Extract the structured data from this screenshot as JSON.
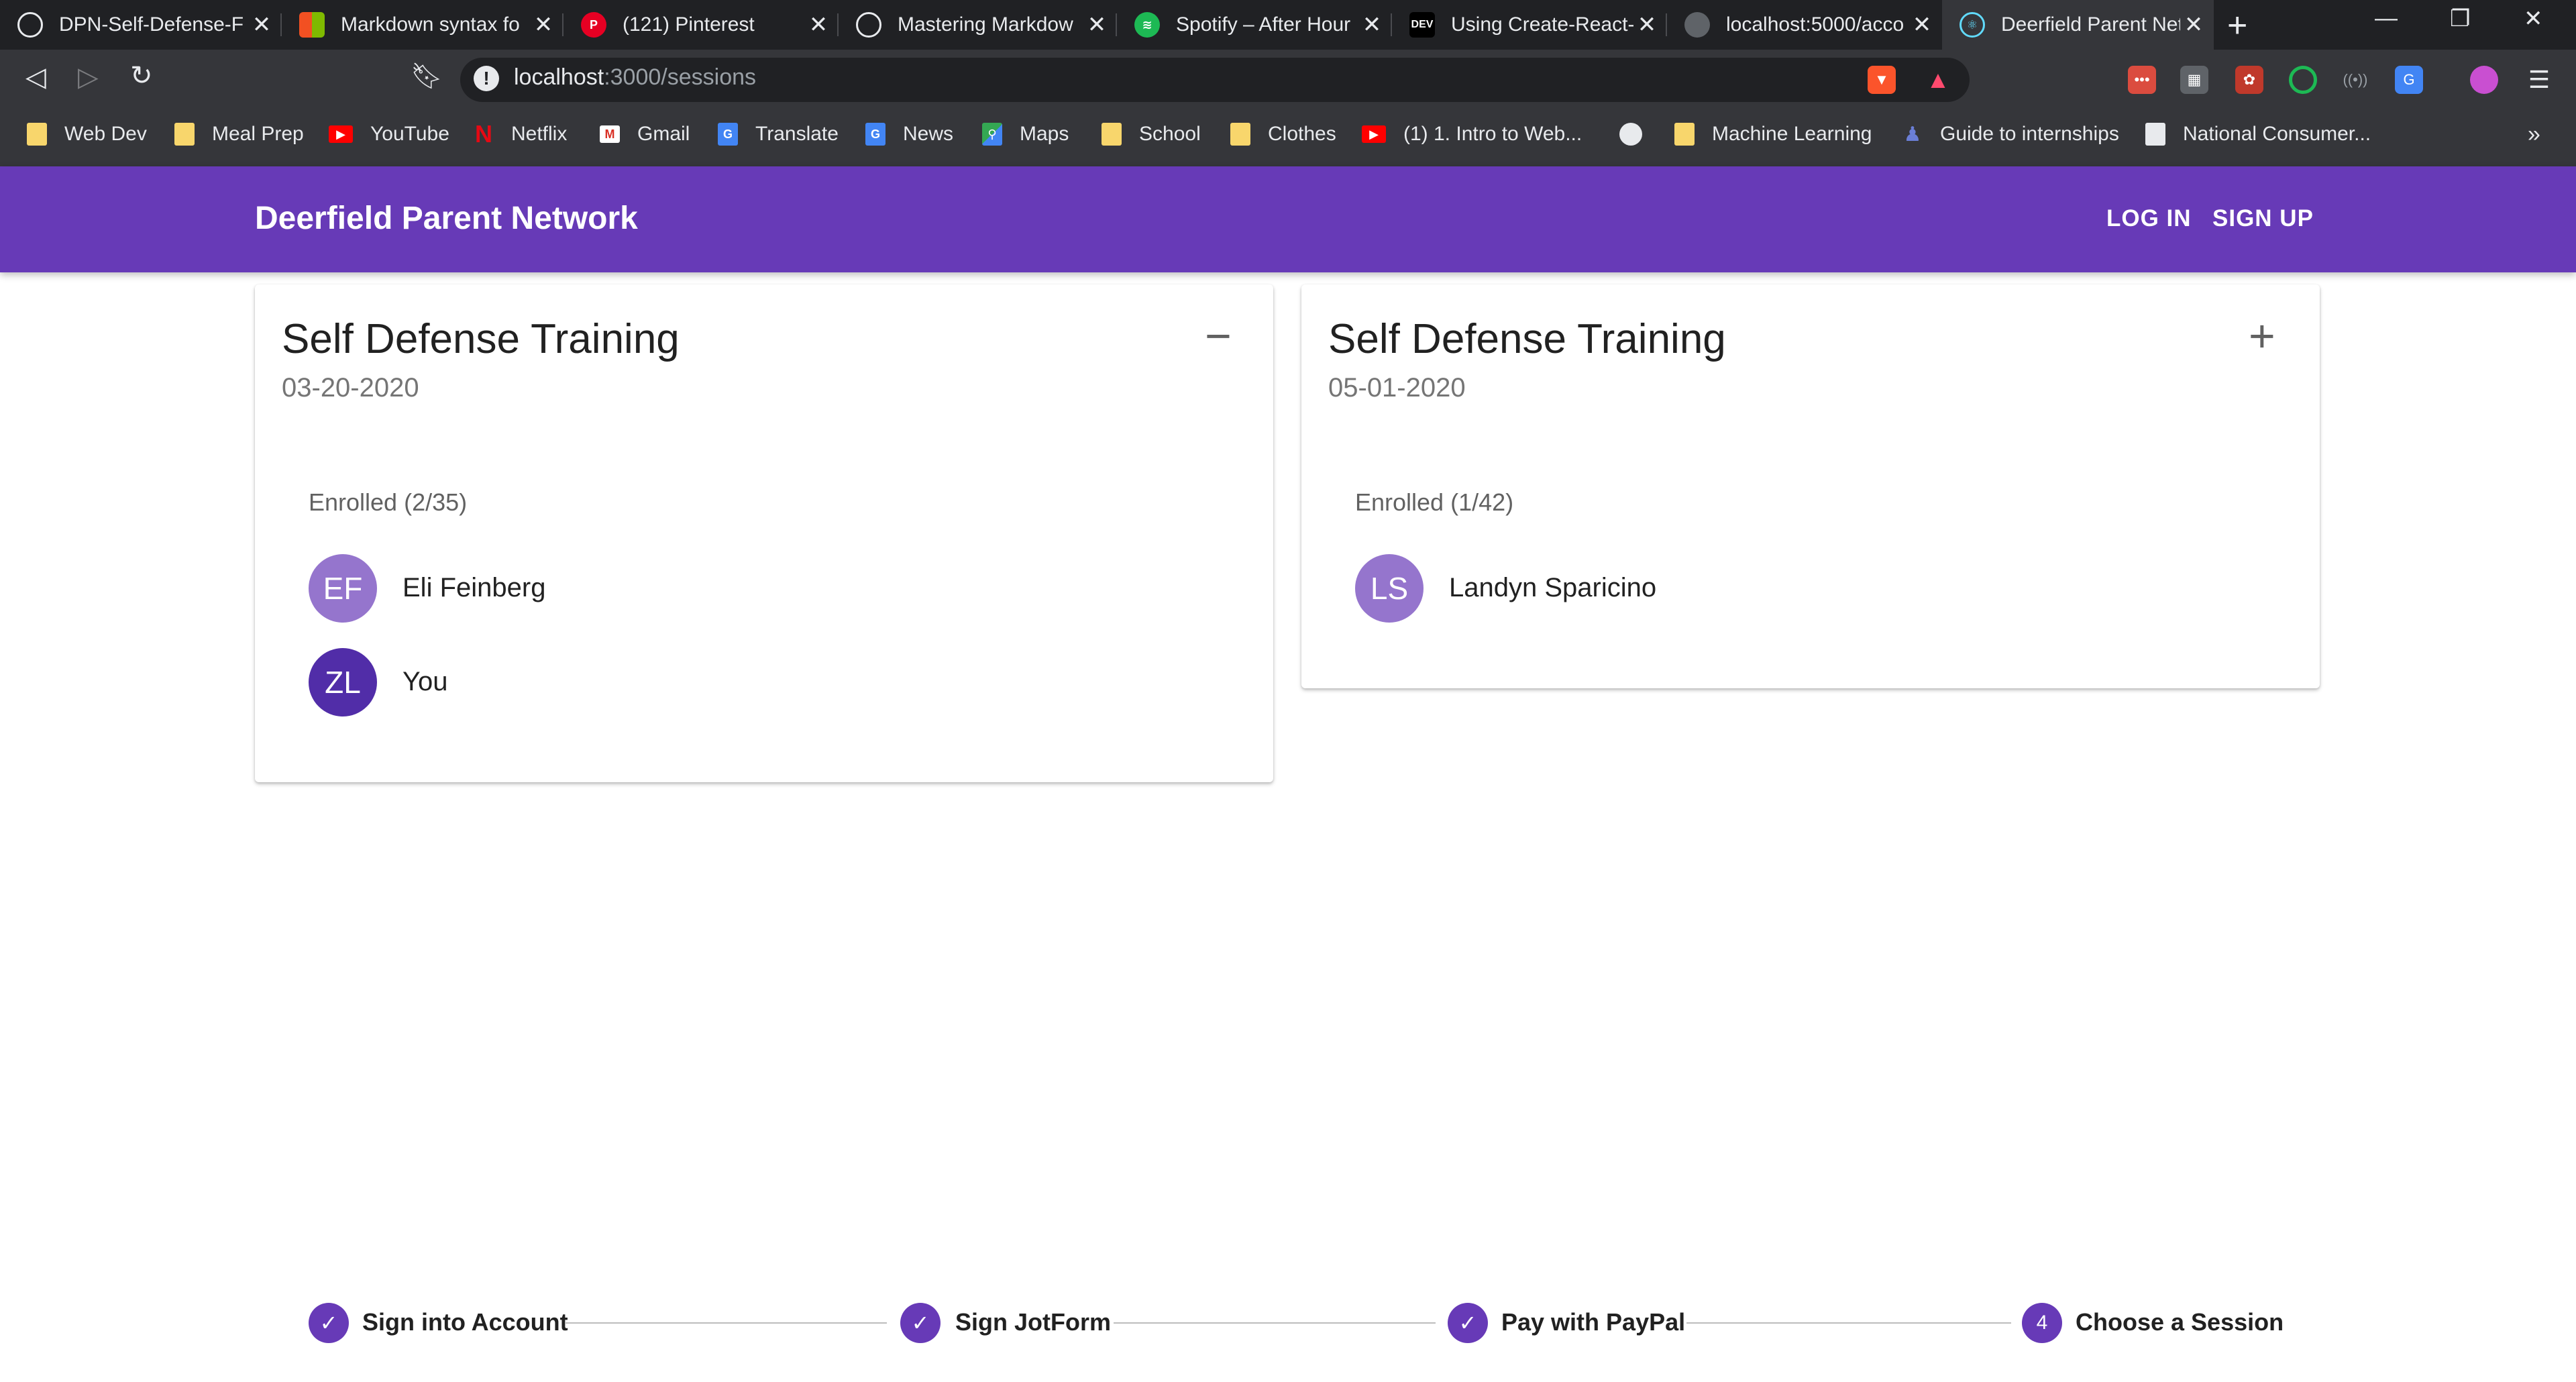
{
  "browser": {
    "tabs": [
      {
        "title": "DPN-Self-Defense-F",
        "icon": "github-icon",
        "color": "#202124"
      },
      {
        "title": "Markdown syntax fo",
        "icon": "microsoft-icon",
        "color": "#f25022"
      },
      {
        "title": "(121) Pinterest",
        "icon": "pinterest-icon",
        "color": "#e60023"
      },
      {
        "title": "Mastering Markdow",
        "icon": "github-icon",
        "color": "#202124"
      },
      {
        "title": "Spotify – After Hour",
        "icon": "spotify-icon",
        "color": "#1db954"
      },
      {
        "title": "Using Create-React-",
        "icon": "dev-icon",
        "color": "#000000"
      },
      {
        "title": "localhost:5000/acco",
        "icon": "globe-icon",
        "color": "#5f6368"
      },
      {
        "title": "Deerfield Parent Net",
        "icon": "react-icon",
        "color": "#61dafb"
      }
    ],
    "new_tab_label": "+",
    "url_host": "localhost",
    "url_path": ":3000/sessions",
    "bookmarks": [
      {
        "label": "Web Dev",
        "icon": "folder-icon"
      },
      {
        "label": "Meal Prep",
        "icon": "folder-icon"
      },
      {
        "label": "YouTube",
        "icon": "youtube-icon"
      },
      {
        "label": "Netflix",
        "icon": "netflix-icon"
      },
      {
        "label": "Gmail",
        "icon": "gmail-icon"
      },
      {
        "label": "Translate",
        "icon": "translate-icon"
      },
      {
        "label": "News",
        "icon": "news-icon"
      },
      {
        "label": "Maps",
        "icon": "maps-icon"
      },
      {
        "label": "School",
        "icon": "folder-icon"
      },
      {
        "label": "Clothes",
        "icon": "folder-icon"
      },
      {
        "label": "(1) 1. Intro to Web...",
        "icon": "youtube-icon"
      },
      {
        "label": "",
        "icon": "globe-icon"
      },
      {
        "label": "Machine Learning",
        "icon": "folder-icon"
      },
      {
        "label": "Guide to internships",
        "icon": "figure-icon"
      },
      {
        "label": "National Consumer...",
        "icon": "page-icon"
      }
    ],
    "more_bookmarks": "»"
  },
  "app": {
    "title": "Deerfield Parent Network",
    "login_label": "LOG IN",
    "signup_label": "SIGN UP",
    "accent": "#673ab7"
  },
  "sessions": [
    {
      "title": "Self Defense Training",
      "date": "03-20-2020",
      "toggle": "−",
      "enrolled": "Enrolled (2/35)",
      "members": [
        {
          "initials": "EF",
          "name": "Eli Feinberg",
          "color": "#9575cd"
        },
        {
          "initials": "ZL",
          "name": "You",
          "color": "#512da8"
        }
      ]
    },
    {
      "title": "Self Defense Training",
      "date": "05-01-2020",
      "toggle": "+",
      "enrolled": "Enrolled (1/42)",
      "members": [
        {
          "initials": "LS",
          "name": "Landyn Sparicino",
          "color": "#9575cd"
        }
      ]
    }
  ],
  "stepper": [
    {
      "label": "Sign into Account",
      "icon": "check-icon",
      "mark": "✓"
    },
    {
      "label": "Sign JotForm",
      "icon": "check-icon",
      "mark": "✓"
    },
    {
      "label": "Pay with PayPal",
      "icon": "check-icon",
      "mark": "✓"
    },
    {
      "label": "Choose a Session",
      "icon": "step-number",
      "mark": "4"
    }
  ]
}
